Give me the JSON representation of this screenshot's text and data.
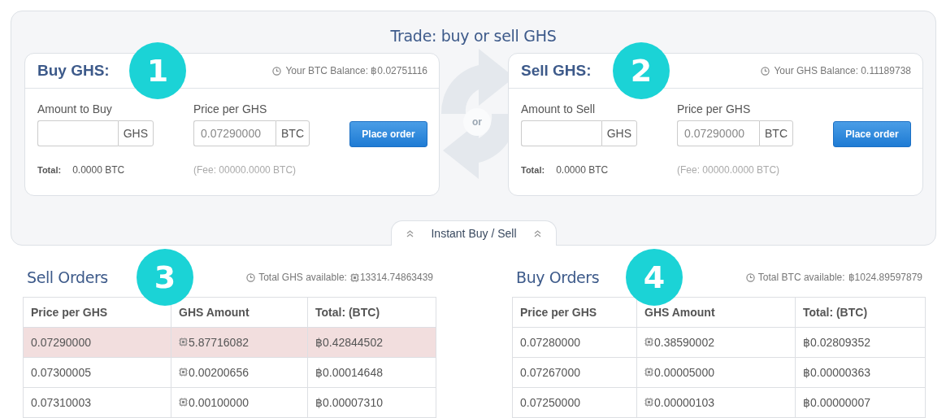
{
  "trade_panel": {
    "title": "Trade: buy or sell GHS",
    "divider_label": "or",
    "cards": [
      {
        "title": "Buy GHS:",
        "balance": "Your BTC Balance: ฿0.02751116",
        "amount_label": "Amount to Buy",
        "amount_unit": "GHS",
        "price_label": "Price per GHS",
        "price_value": "0.07290000",
        "price_unit": "BTC",
        "button": "Place order",
        "total_label": "Total:",
        "total_value": "0.0000 BTC",
        "fee": "(Fee: 00000.0000 BTC)",
        "callout": "1"
      },
      {
        "title": "Sell GHS:",
        "balance": "Your GHS Balance: 0.11189738",
        "amount_label": "Amount to Sell",
        "amount_unit": "GHS",
        "price_label": "Price per GHS",
        "price_value": "0.07290000",
        "price_unit": "BTC",
        "button": "Place order",
        "total_label": "Total:",
        "total_value": "0.0000 BTC",
        "fee": "(Fee: 00000.0000 BTC)",
        "callout": "2"
      }
    ],
    "instant_tab": {
      "label": "Instant Buy / Sell"
    }
  },
  "order_books": [
    {
      "title": "Sell Orders",
      "callout": "3",
      "available": {
        "label": "Total GHS available:",
        "kind": "ghs",
        "value": "13314.74863439"
      },
      "columns": [
        "Price per GHS",
        "GHS Amount",
        "Total: (BTC)"
      ],
      "rows": [
        {
          "price": "0.07290000",
          "amount": "5.87716082",
          "total": "฿0.42844502",
          "highlighted": true
        },
        {
          "price": "0.07300005",
          "amount": "0.00200656",
          "total": "฿0.00014648",
          "highlighted": false
        },
        {
          "price": "0.07310003",
          "amount": "0.00100000",
          "total": "฿0.00007310",
          "highlighted": false
        }
      ]
    },
    {
      "title": "Buy Orders",
      "callout": "4",
      "available": {
        "label": "Total BTC available:",
        "kind": "btc",
        "value": "฿1024.89597879"
      },
      "columns": [
        "Price per GHS",
        "GHS Amount",
        "Total: (BTC)"
      ],
      "rows": [
        {
          "price": "0.07280000",
          "amount": "0.38590002",
          "total": "฿0.02809352",
          "highlighted": false
        },
        {
          "price": "0.07267000",
          "amount": "0.00005000",
          "total": "฿0.00000363",
          "highlighted": false
        },
        {
          "price": "0.07250000",
          "amount": "0.00000103",
          "total": "฿0.00000007",
          "highlighted": false
        }
      ]
    }
  ]
}
